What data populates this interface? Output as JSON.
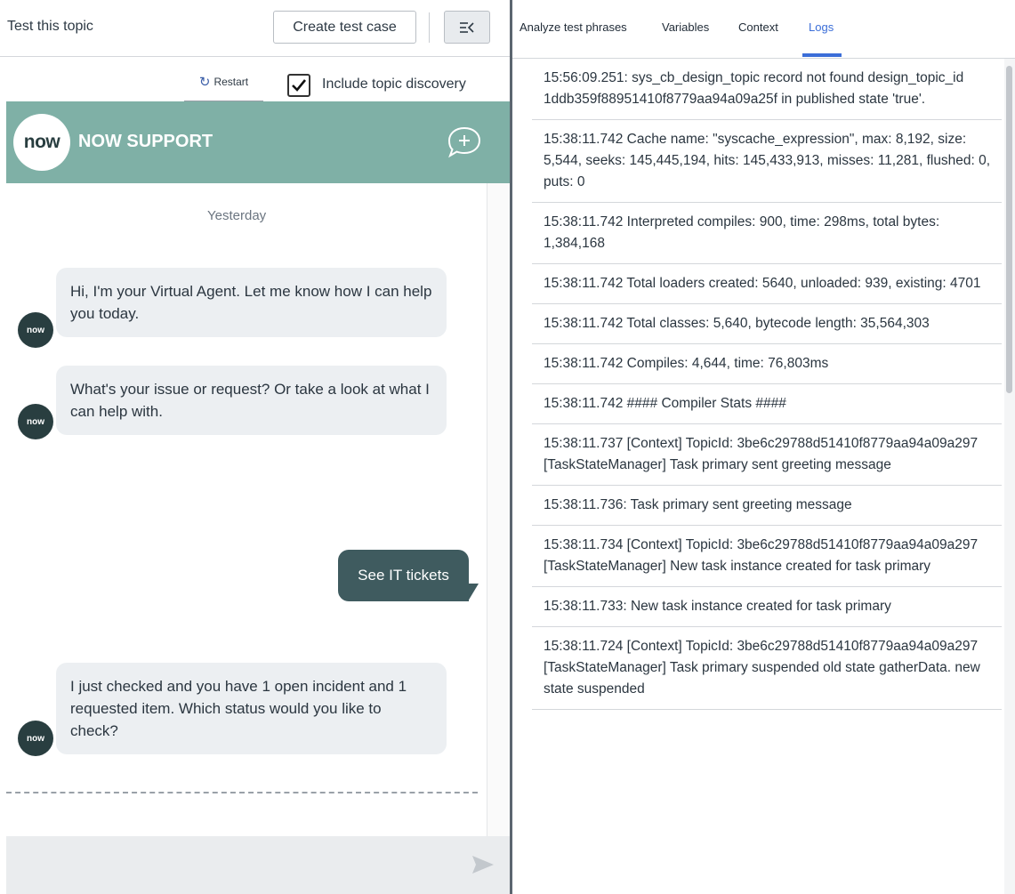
{
  "left_panel": {
    "title": "Test this topic",
    "create_test_case_label": "Create test case",
    "collapse_icon": "collapse-panel-icon",
    "restart_label": "Restart",
    "include_discovery_label": "Include topic discovery",
    "include_discovery_checked": true
  },
  "chat": {
    "logo_text": "now",
    "header_title": "NOW SUPPORT",
    "header_color": "#7fb0a6",
    "day_label": "Yesterday",
    "avatar_text": "now",
    "messages": [
      {
        "from": "bot",
        "text": "Hi, I'm your Virtual Agent. Let me know how I can help you today."
      },
      {
        "from": "bot",
        "text": "What's your issue or request? Or take a look at what I can help with."
      },
      {
        "from": "user",
        "text": "See IT tickets"
      },
      {
        "from": "bot",
        "text": "I just checked and you have 1 open incident and 1 requested item.  Which status would you like to check?"
      }
    ],
    "user_bubble_color": "#3f5b5f",
    "send_icon": "send-icon"
  },
  "right_panel": {
    "tabs": [
      {
        "label": "Analyze test phrases"
      },
      {
        "label": "Variables"
      },
      {
        "label": "Context"
      },
      {
        "label": "Logs",
        "active": true
      }
    ],
    "accent_color": "#3b6ed8",
    "logs": [
      "15:56:09.251: sys_cb_design_topic record not found design_topic_id 1ddb359f88951410f8779aa94a09a25f in published state 'true'.",
      "15:38:11.742 Cache name: \"syscache_expression\", max: 8,192, size: 5,544, seeks: 145,445,194, hits: 145,433,913, misses: 11,281, flushed: 0, puts: 0",
      "15:38:11.742 Interpreted compiles: 900, time: 298ms, total bytes: 1,384,168",
      "15:38:11.742 Total loaders created: 5640, unloaded: 939, existing: 4701",
      "15:38:11.742 Total classes: 5,640, bytecode length: 35,564,303",
      "15:38:11.742 Compiles: 4,644, time: 76,803ms",
      "15:38:11.742 #### Compiler Stats ####",
      "15:38:11.737 [Context] TopicId: 3be6c29788d51410f8779aa94a09a297 [TaskStateManager] Task primary sent greeting message",
      "15:38:11.736: Task primary sent greeting message",
      "15:38:11.734 [Context] TopicId: 3be6c29788d51410f8779aa94a09a297 [TaskStateManager] New task instance created for task primary",
      "15:38:11.733: New task instance created for task primary",
      "15:38:11.724 [Context] TopicId: 3be6c29788d51410f8779aa94a09a297 [TaskStateManager] Task primary suspended old state gatherData. new state suspended"
    ]
  }
}
